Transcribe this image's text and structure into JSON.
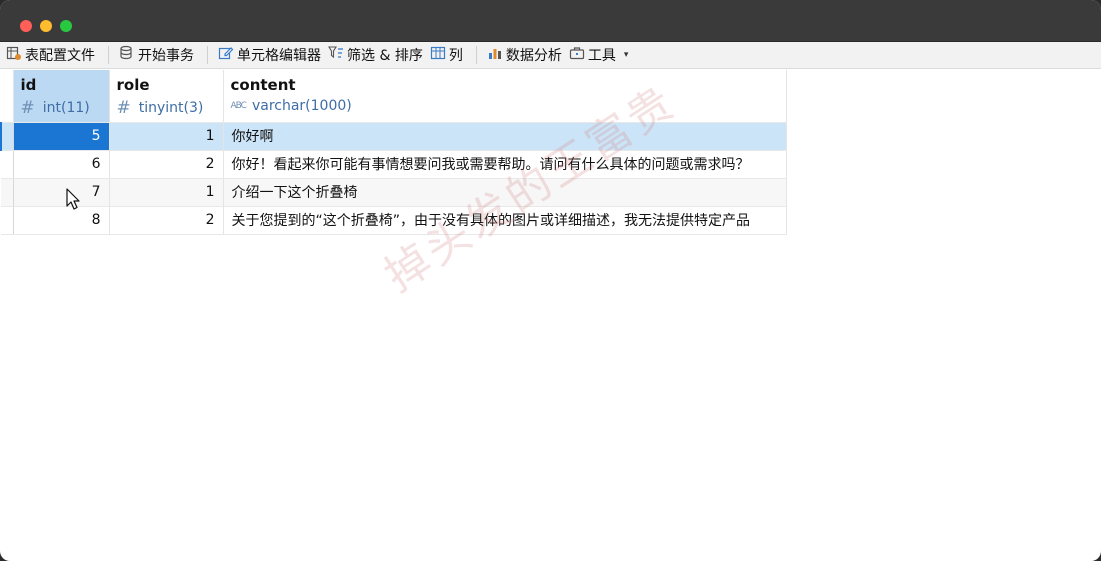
{
  "toolbar": {
    "items": [
      {
        "label": "表配置文件",
        "icon": "table-config-icon"
      },
      {
        "label": "开始事务",
        "icon": "database-icon"
      },
      {
        "label": "单元格编辑器",
        "icon": "edit-pencil-icon"
      },
      {
        "label": "筛选 & 排序",
        "icon": "filter-sort-icon"
      },
      {
        "label": "列",
        "icon": "columns-icon"
      },
      {
        "label": "数据分析",
        "icon": "chart-icon"
      },
      {
        "label": "工具",
        "icon": "toolbox-icon"
      }
    ],
    "tools_caret": "▾"
  },
  "table": {
    "columns": [
      {
        "name": "id",
        "type": "int(11)",
        "type_glyph": "#"
      },
      {
        "name": "role",
        "type": "tinyint(3)",
        "type_glyph": "#"
      },
      {
        "name": "content",
        "type": "varchar(1000)",
        "type_glyph": "ABC"
      }
    ],
    "rows": [
      {
        "id": "5",
        "role": "1",
        "content": "你好啊"
      },
      {
        "id": "6",
        "role": "2",
        "content": "你好！看起来你可能有事情想要问我或需要帮助。请问有什么具体的问题或需求吗？"
      },
      {
        "id": "7",
        "role": "1",
        "content": "介绍一下这个折叠椅"
      },
      {
        "id": "8",
        "role": "2",
        "content": "关于您提到的“这个折叠椅”，由于没有具体的图片或详细描述，我无法提供特定产品"
      }
    ],
    "selected_row": 0
  },
  "watermark": "掉头发的王富贵",
  "colors": {
    "selection": "#1a76d2",
    "row_highlight": "#cce4f7",
    "header_selected": "#bcd9f3",
    "type_text": "#3e6ea6"
  }
}
